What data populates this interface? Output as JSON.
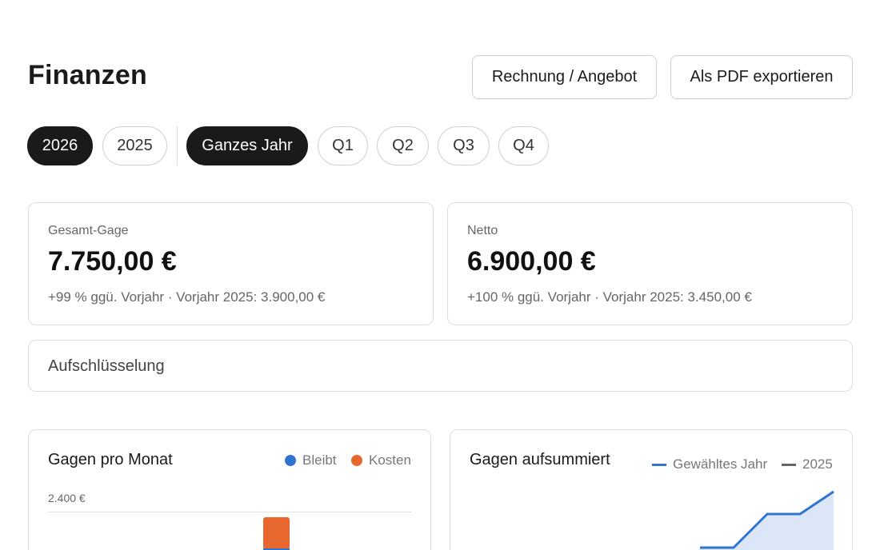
{
  "header": {
    "title": "Finanzen",
    "invoice_button": "Rechnung / Angebot",
    "pdf_button": "Als PDF exportieren"
  },
  "filters": {
    "years": [
      {
        "label": "2026",
        "active": true
      },
      {
        "label": "2025",
        "active": false
      }
    ],
    "periods": [
      {
        "label": "Ganzes Jahr",
        "active": true
      },
      {
        "label": "Q1",
        "active": false
      },
      {
        "label": "Q2",
        "active": false
      },
      {
        "label": "Q3",
        "active": false
      },
      {
        "label": "Q4",
        "active": false
      }
    ]
  },
  "kpis": {
    "gross": {
      "label": "Gesamt-Gage",
      "value": "7.750,00 €",
      "delta": "+99 % ggü. Vorjahr · Vorjahr 2025: 3.900,00 €"
    },
    "net": {
      "label": "Netto",
      "value": "6.900,00 €",
      "delta": "+100 % ggü. Vorjahr · Vorjahr 2025: 3.450,00 €"
    }
  },
  "breakdown": {
    "label": "Aufschlüsselung"
  },
  "monthly_chart": {
    "title": "Gagen pro Monat",
    "legend_remains": "Bleibt",
    "legend_costs": "Kosten",
    "y_tick_top": "2.400 €"
  },
  "cumulative_chart": {
    "title": "Gagen aufsummiert",
    "legend_selected": "Gewähltes Jahr",
    "legend_previous": "2025"
  },
  "colors": {
    "remains": "#2f74d0",
    "costs": "#e8672f",
    "selected_line": "#2f74d0",
    "previous_line": "#666666",
    "active_pill": "#1a1a1a"
  }
}
